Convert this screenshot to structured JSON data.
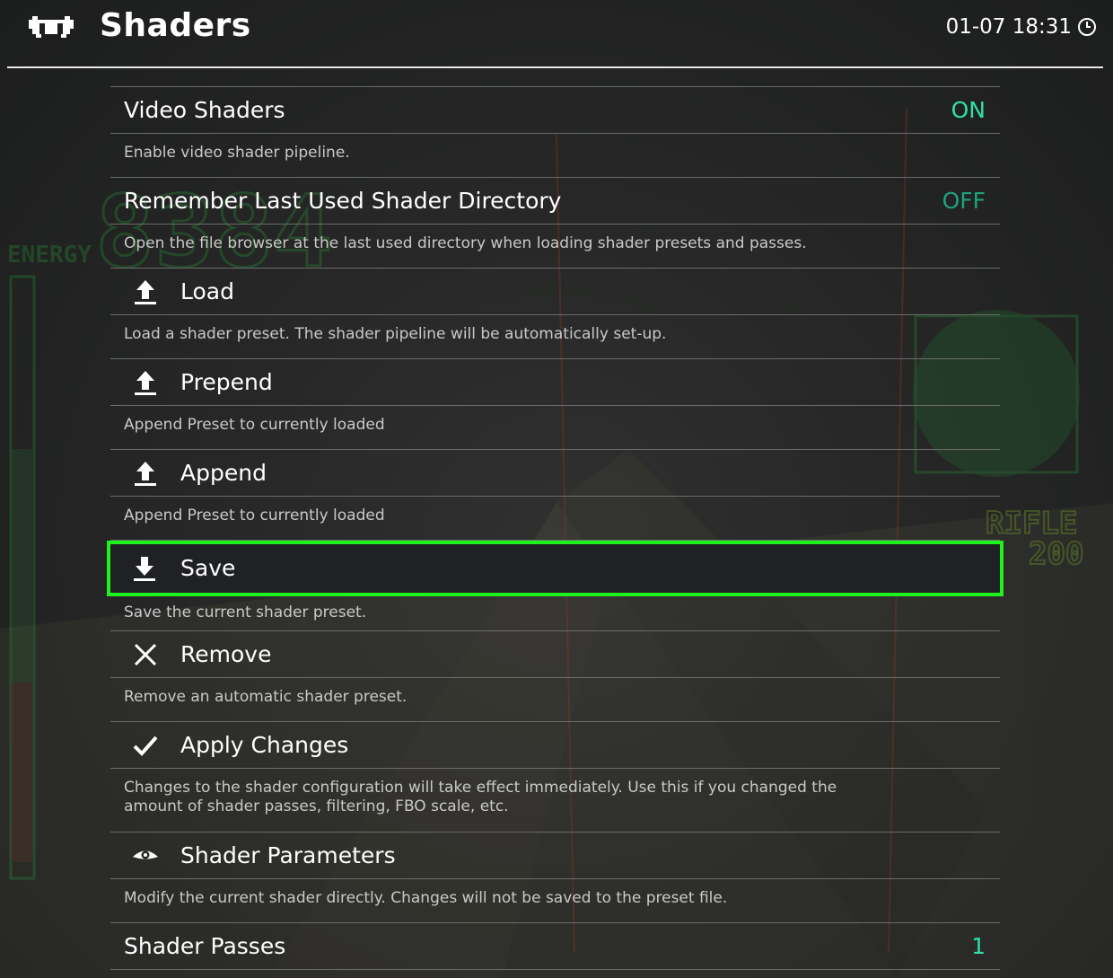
{
  "header": {
    "title": "Shaders",
    "clock": "01-07 18:31"
  },
  "colors": {
    "selection": "#1ef11c",
    "value_on": "#2fe0a8",
    "value_off": "#1ea37c"
  },
  "menu": {
    "items": [
      {
        "label": "Video Shaders",
        "value": "ON",
        "icon": null,
        "desc": "Enable video shader pipeline."
      },
      {
        "label": "Remember Last Used Shader Directory",
        "value": "OFF",
        "icon": null,
        "desc": "Open the file browser at the last used directory when loading shader presets and passes."
      },
      {
        "label": "Load",
        "icon": "upload-icon",
        "desc": "Load a shader preset. The shader pipeline will be automatically set-up."
      },
      {
        "label": "Prepend",
        "icon": "upload-icon",
        "desc": "Append Preset to currently loaded"
      },
      {
        "label": "Append",
        "icon": "upload-icon",
        "desc": "Append Preset to currently loaded"
      },
      {
        "label": "Save",
        "icon": "download-icon",
        "desc": "Save the current shader preset.",
        "selected": true
      },
      {
        "label": "Remove",
        "icon": "close-icon",
        "desc": "Remove an automatic shader preset."
      },
      {
        "label": "Apply Changes",
        "icon": "checkmark-icon",
        "desc": "Changes to the shader configuration will take effect immediately. Use this if you changed the amount of shader passes, filtering, FBO scale, etc."
      },
      {
        "label": "Shader Parameters",
        "icon": "eye-icon",
        "desc": "Modify the current shader directly. Changes will not be saved to the preset file."
      },
      {
        "label": "Shader Passes",
        "value": "1",
        "icon": null
      }
    ]
  },
  "background": {
    "hud_energy": "ENERGY",
    "hud_number": "8384",
    "hud_weapon": "RIFLE",
    "hud_ammo": "200"
  }
}
